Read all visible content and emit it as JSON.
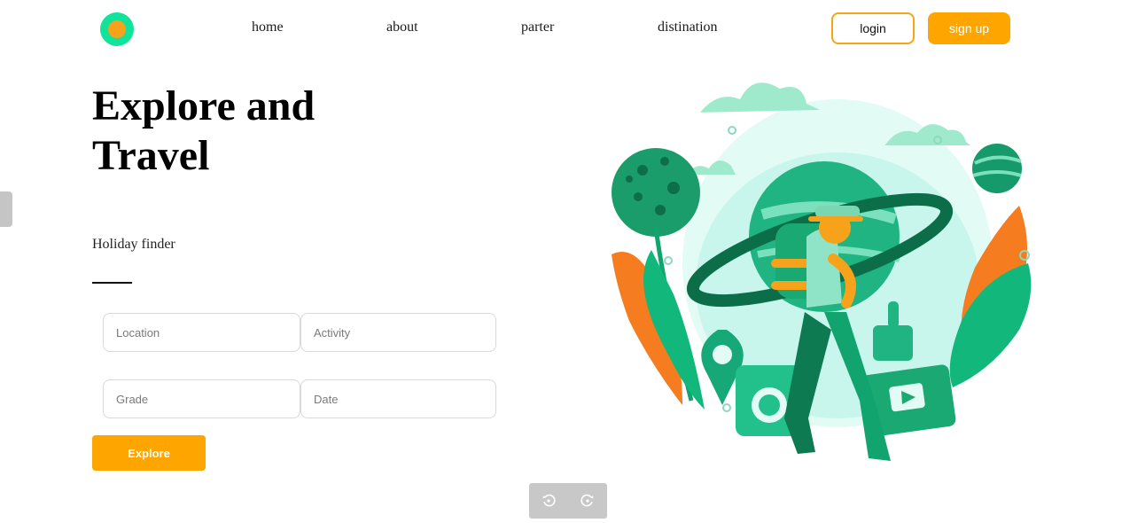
{
  "nav": {
    "links": [
      "home",
      "about",
      "parter",
      "distination"
    ],
    "login_label": "login",
    "signup_label": "sign up"
  },
  "hero": {
    "title_line1": "Explore and",
    "title_line2": "Travel",
    "subtitle": "Holiday finder"
  },
  "form": {
    "location_placeholder": "Location",
    "activity_placeholder": "Activity",
    "grade_placeholder": "Grade",
    "date_placeholder": "Date",
    "explore_label": "Explore"
  },
  "colors": {
    "accent": "#ffa500",
    "logo_outer": "#12e39a",
    "logo_inner": "#f7a21b",
    "illustration_green": "#1aa873",
    "illustration_orange": "#f57c1f"
  },
  "icons": [
    "rotate-left-icon",
    "rotate-right-icon"
  ]
}
